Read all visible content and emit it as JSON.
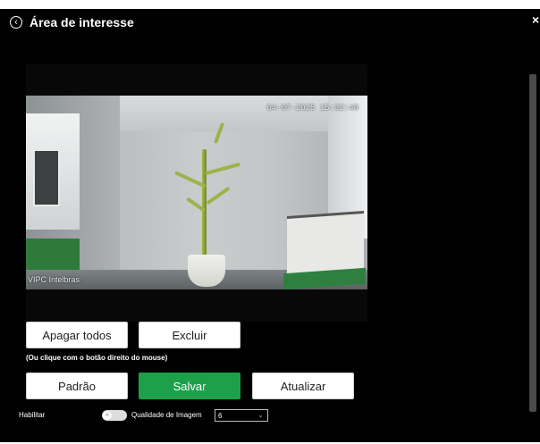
{
  "dialog": {
    "title": "Área de interesse",
    "back_icon": "chevron-left-circle-icon",
    "close_symbol": "×"
  },
  "video": {
    "timestamp": "04-07-2025 15:32:48",
    "camera_name": "VIPC Intelbras"
  },
  "actions": {
    "clear_all_label": "Apagar todos",
    "delete_label": "Excluir",
    "hint": "(Ou clique com o botão direito do mouse)"
  },
  "footer": {
    "default_label": "Padrão",
    "save_label": "Salvar",
    "refresh_label": "Atualizar"
  },
  "settings": {
    "enable_label": "Habilitar",
    "enable_state": "off",
    "quality_label": "Qualidade de Imagem",
    "quality_value": "6"
  },
  "colors": {
    "background": "#000000",
    "primary": "#1ca14a"
  }
}
